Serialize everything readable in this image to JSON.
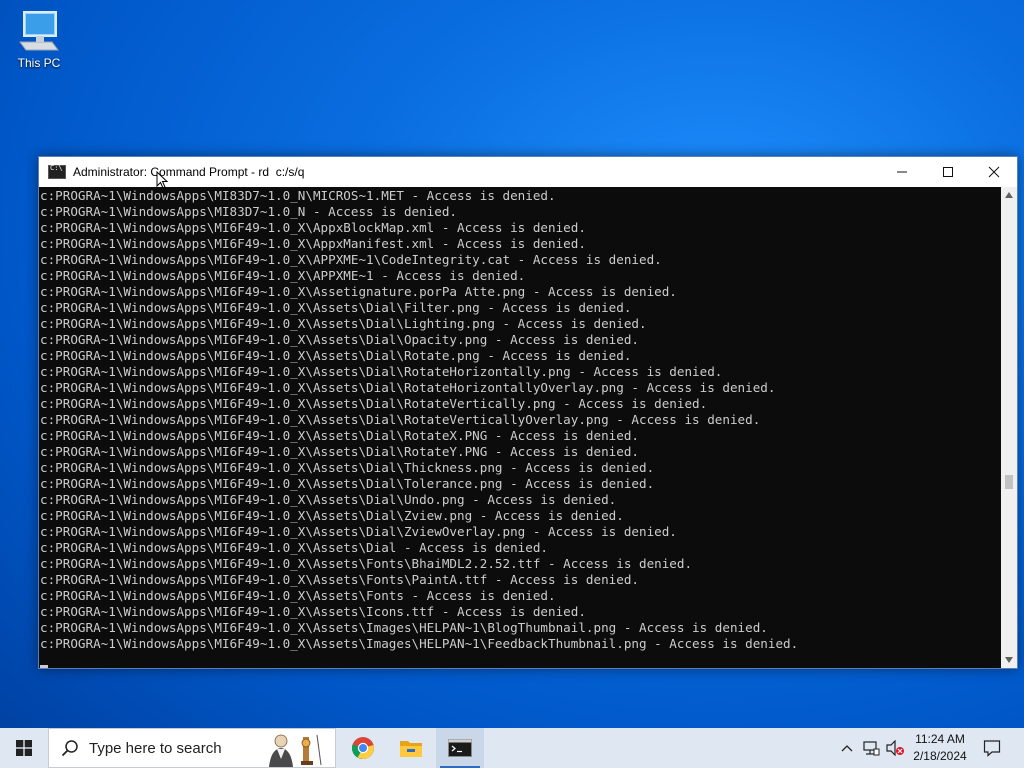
{
  "desktop": {
    "icons": [
      {
        "label": "This PC",
        "icon": "computer-icon"
      }
    ]
  },
  "window": {
    "title": "Administrator: Command Prompt - rd  c:/s/q",
    "controls": [
      "minimize",
      "maximize",
      "close"
    ],
    "console_lines": [
      "c:PROGRA~1\\WindowsApps\\MI83D7~1.0_N\\MICROS~1.MET - Access is denied.",
      "c:PROGRA~1\\WindowsApps\\MI83D7~1.0_N - Access is denied.",
      "c:PROGRA~1\\WindowsApps\\MI6F49~1.0_X\\AppxBlockMap.xml - Access is denied.",
      "c:PROGRA~1\\WindowsApps\\MI6F49~1.0_X\\AppxManifest.xml - Access is denied.",
      "c:PROGRA~1\\WindowsApps\\MI6F49~1.0_X\\APPXME~1\\CodeIntegrity.cat - Access is denied.",
      "c:PROGRA~1\\WindowsApps\\MI6F49~1.0_X\\APPXME~1 - Access is denied.",
      "c:PROGRA~1\\WindowsApps\\MI6F49~1.0_X\\Assetignature.porPa Atte.png - Access is denied.",
      "c:PROGRA~1\\WindowsApps\\MI6F49~1.0_X\\Assets\\Dial\\Filter.png - Access is denied.",
      "c:PROGRA~1\\WindowsApps\\MI6F49~1.0_X\\Assets\\Dial\\Lighting.png - Access is denied.",
      "c:PROGRA~1\\WindowsApps\\MI6F49~1.0_X\\Assets\\Dial\\Opacity.png - Access is denied.",
      "c:PROGRA~1\\WindowsApps\\MI6F49~1.0_X\\Assets\\Dial\\Rotate.png - Access is denied.",
      "c:PROGRA~1\\WindowsApps\\MI6F49~1.0_X\\Assets\\Dial\\RotateHorizontally.png - Access is denied.",
      "c:PROGRA~1\\WindowsApps\\MI6F49~1.0_X\\Assets\\Dial\\RotateHorizontallyOverlay.png - Access is denied.",
      "c:PROGRA~1\\WindowsApps\\MI6F49~1.0_X\\Assets\\Dial\\RotateVertically.png - Access is denied.",
      "c:PROGRA~1\\WindowsApps\\MI6F49~1.0_X\\Assets\\Dial\\RotateVerticallyOverlay.png - Access is denied.",
      "c:PROGRA~1\\WindowsApps\\MI6F49~1.0_X\\Assets\\Dial\\RotateX.PNG - Access is denied.",
      "c:PROGRA~1\\WindowsApps\\MI6F49~1.0_X\\Assets\\Dial\\RotateY.PNG - Access is denied.",
      "c:PROGRA~1\\WindowsApps\\MI6F49~1.0_X\\Assets\\Dial\\Thickness.png - Access is denied.",
      "c:PROGRA~1\\WindowsApps\\MI6F49~1.0_X\\Assets\\Dial\\Tolerance.png - Access is denied.",
      "c:PROGRA~1\\WindowsApps\\MI6F49~1.0_X\\Assets\\Dial\\Undo.png - Access is denied.",
      "c:PROGRA~1\\WindowsApps\\MI6F49~1.0_X\\Assets\\Dial\\Zview.png - Access is denied.",
      "c:PROGRA~1\\WindowsApps\\MI6F49~1.0_X\\Assets\\Dial\\ZviewOverlay.png - Access is denied.",
      "c:PROGRA~1\\WindowsApps\\MI6F49~1.0_X\\Assets\\Dial - Access is denied.",
      "c:PROGRA~1\\WindowsApps\\MI6F49~1.0_X\\Assets\\Fonts\\BhaiMDL2.2.52.ttf - Access is denied.",
      "c:PROGRA~1\\WindowsApps\\MI6F49~1.0_X\\Assets\\Fonts\\PaintA.ttf - Access is denied.",
      "c:PROGRA~1\\WindowsApps\\MI6F49~1.0_X\\Assets\\Fonts - Access is denied.",
      "c:PROGRA~1\\WindowsApps\\MI6F49~1.0_X\\Assets\\Icons.ttf - Access is denied.",
      "c:PROGRA~1\\WindowsApps\\MI6F49~1.0_X\\Assets\\Images\\HELPAN~1\\BlogThumbnail.png - Access is denied.",
      "c:PROGRA~1\\WindowsApps\\MI6F49~1.0_X\\Assets\\Images\\HELPAN~1\\FeedbackThumbnail.png - Access is denied."
    ]
  },
  "taskbar": {
    "search_placeholder": "Type here to search",
    "pinned": [
      "chrome-icon",
      "file-explorer-icon",
      "command-prompt-icon"
    ],
    "tray_icons": [
      "chevron-up-icon",
      "network-icon",
      "volume-muted-icon"
    ],
    "time": "11:24 AM",
    "date": "2/18/2024",
    "notifications_icon": "action-center-icon"
  },
  "colors": {
    "console_bg": "#0c0c0c",
    "console_fg": "#cccccc",
    "taskbar_bg": "#dfe8f2",
    "desktop": "#0a6ee0"
  }
}
